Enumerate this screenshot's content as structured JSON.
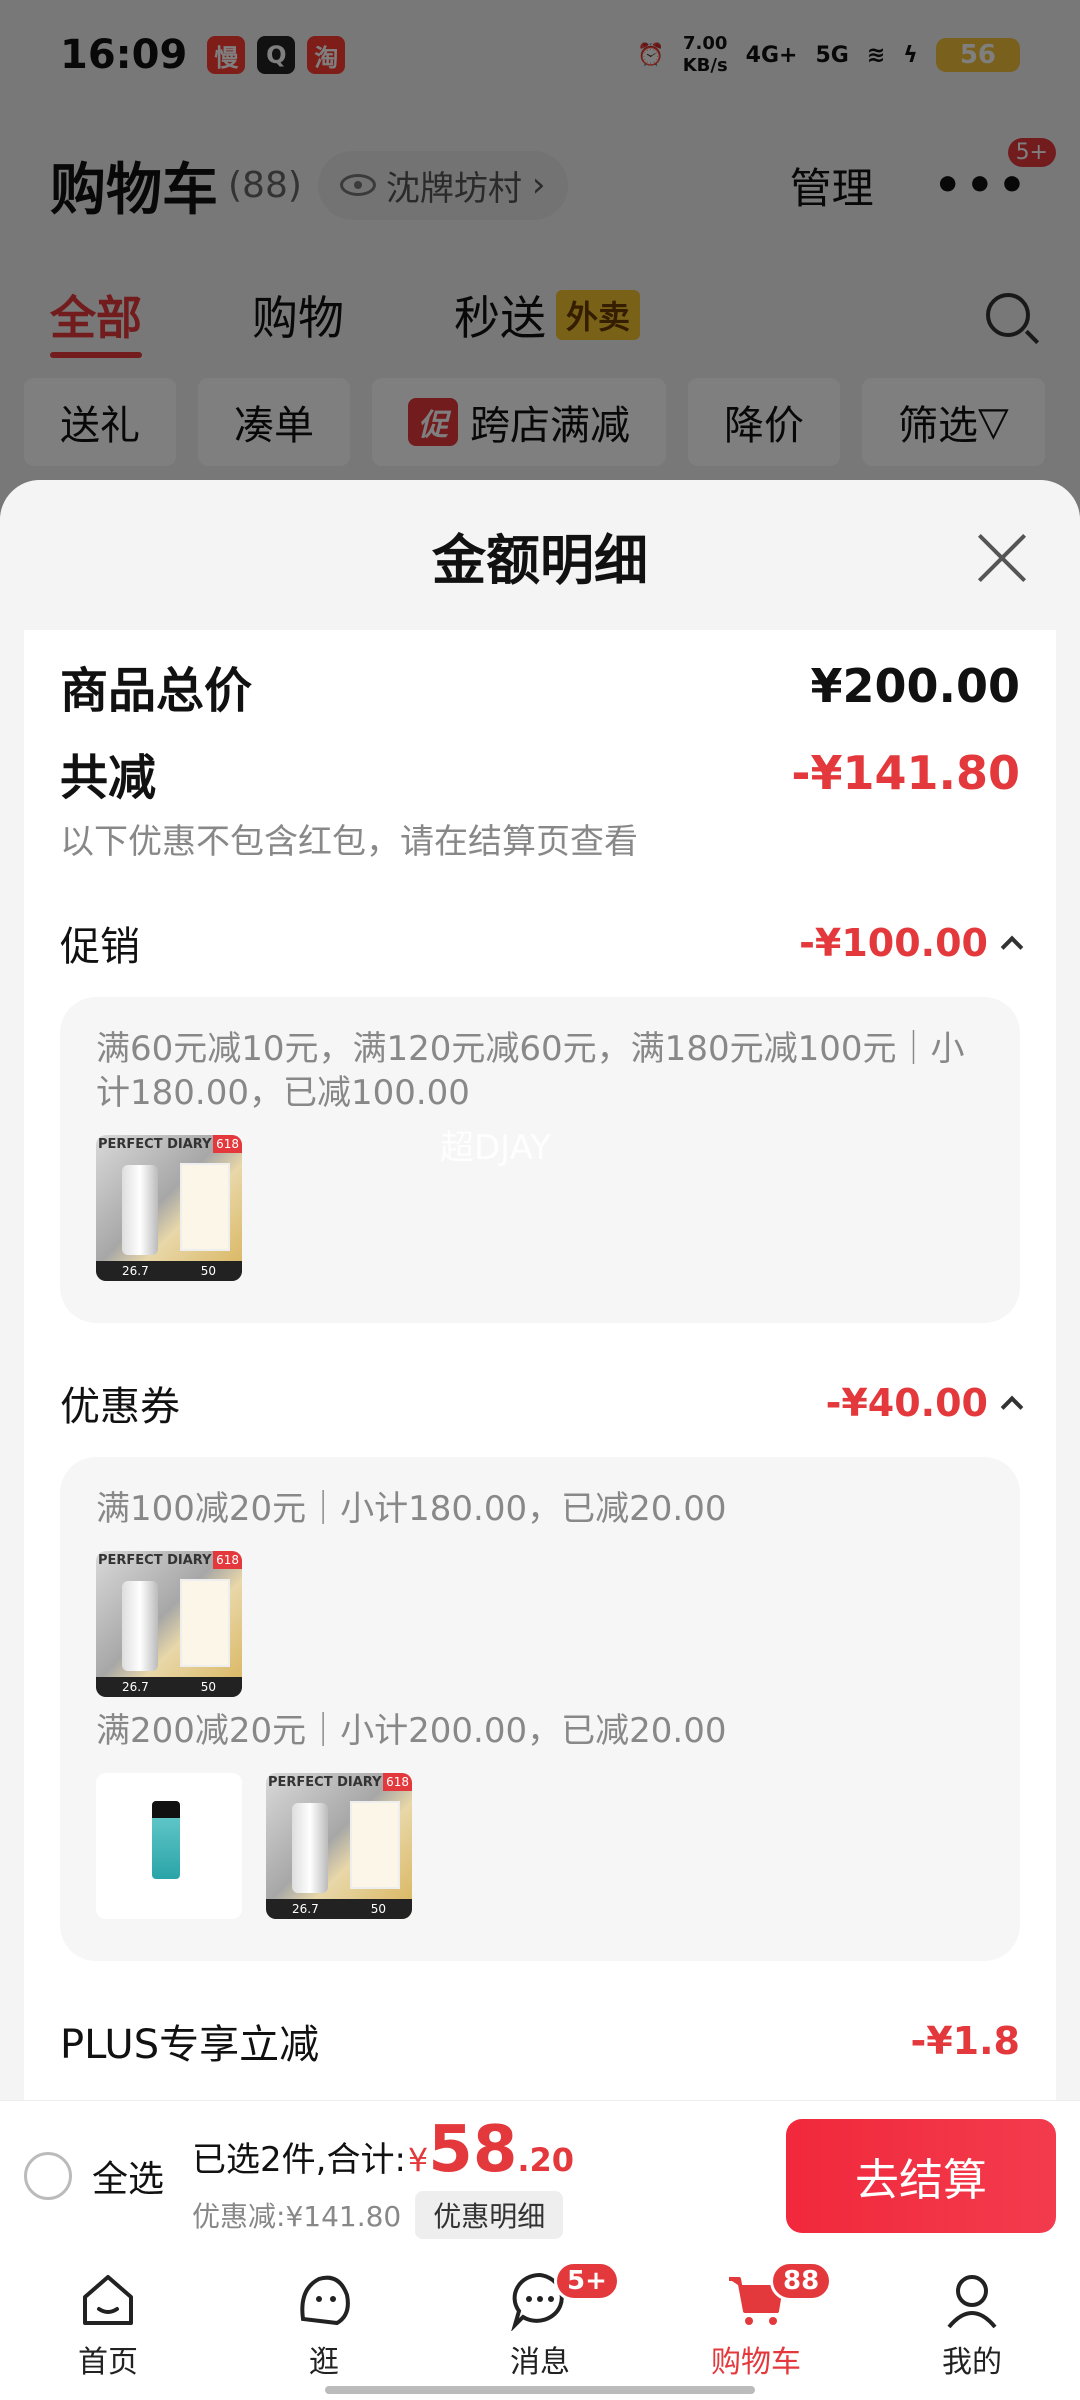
{
  "status_bar": {
    "time": "16:09",
    "apps": [
      "慢",
      "Q",
      "淘"
    ],
    "speed_value": "7.00",
    "speed_unit": "KB/s",
    "net1": "4G+",
    "net2": "5G",
    "battery": "56"
  },
  "cart_header": {
    "title": "购物车",
    "count": "(88)",
    "location": "沈牌坊村",
    "manage_label": "管理",
    "more_badge": "5+"
  },
  "cart_tabs": {
    "all": "全部",
    "shopping": "购物",
    "express": "秒送",
    "takeout_tag": "外卖"
  },
  "filters": {
    "gift": "送礼",
    "bundle": "凑单",
    "promo_tag": "促",
    "cross_store": "跨店满减",
    "price_drop": "降价",
    "filter": "筛选"
  },
  "sheet": {
    "title": "金额明细",
    "total_label": "商品总价",
    "total_value": "¥200.00",
    "reduce_label": "共减",
    "reduce_value": "-¥141.80",
    "reduce_note": "以下优惠不包含红包，请在结算页查看",
    "promotion": {
      "label": "促销",
      "value": "-¥100.00",
      "detail": "满60元减10元，满120元减60元，满180元减100元｜小计180.00，已减100.00"
    },
    "coupon": {
      "label": "优惠券",
      "value": "-¥40.00",
      "detail1": "满100减20元｜小计180.00，已减20.00",
      "detail2": "满200减20元｜小计200.00，已减20.00"
    },
    "plus": {
      "label": "PLUS专享立减",
      "value": "-¥1.8"
    },
    "thumb": {
      "brand": "PERFECT DIARY",
      "tag": "618",
      "price1": "26.7",
      "price2": "50"
    },
    "watermark": "超DJAY"
  },
  "checkout": {
    "select_all": "全选",
    "selected_text": "已选2件,合计:",
    "currency": "¥",
    "total_int": "58",
    "total_dec": ".20",
    "discount_text": "优惠减:¥141.80",
    "detail_chip": "优惠明细",
    "button": "去结算"
  },
  "bottom_nav": {
    "home": "首页",
    "browse": "逛",
    "messages": "消息",
    "messages_badge": "5+",
    "cart": "购物车",
    "cart_badge": "88",
    "mine": "我的"
  },
  "colors": {
    "accent": "#e4393c"
  }
}
